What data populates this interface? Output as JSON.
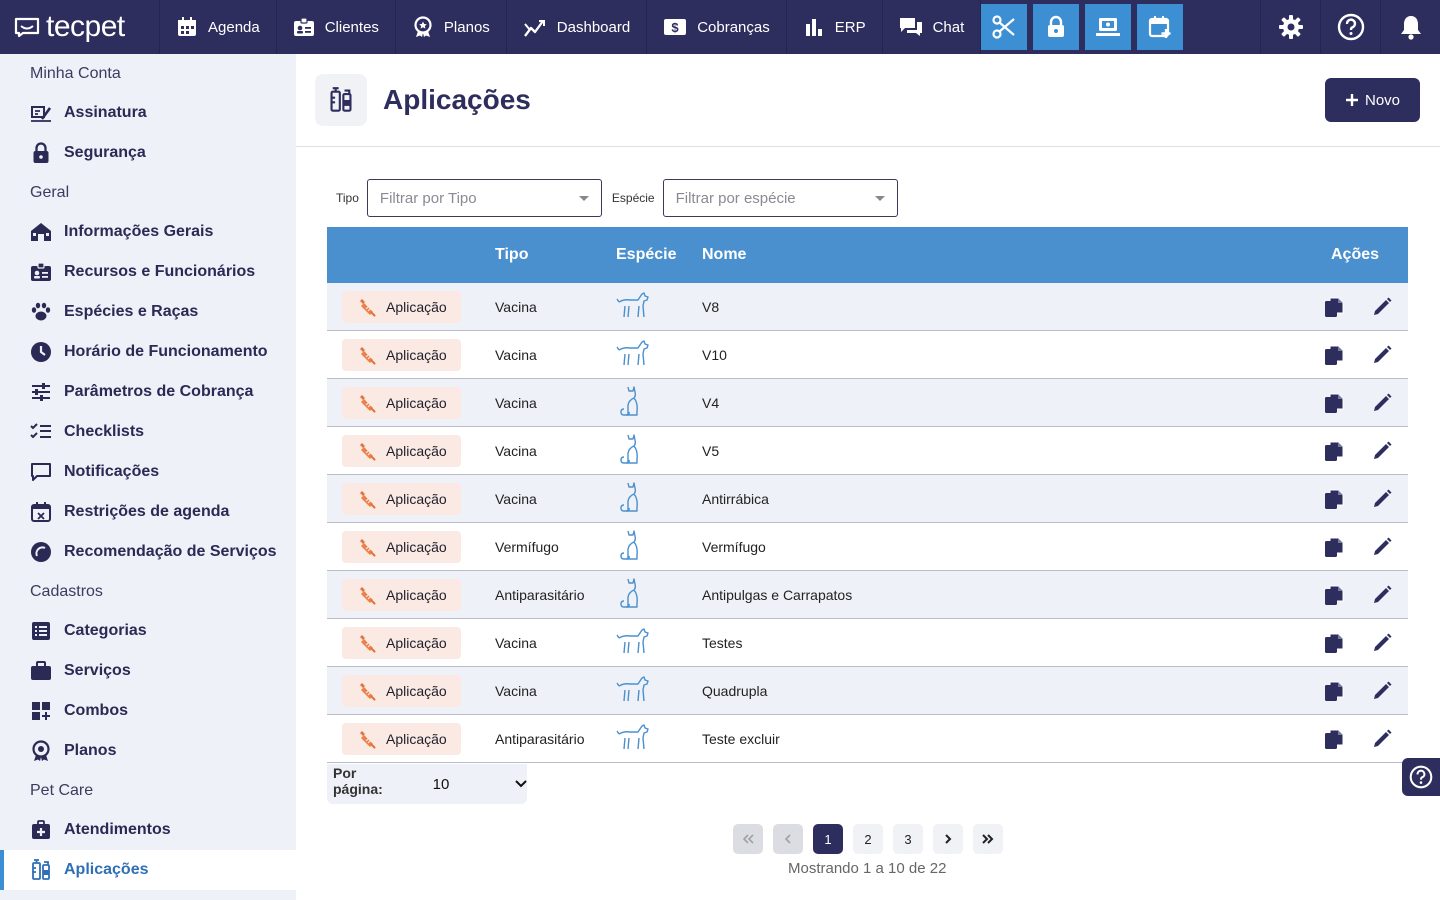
{
  "brand": {
    "name": "tecpet"
  },
  "nav": {
    "items": [
      {
        "label": "Agenda",
        "icon": "calendar-icon"
      },
      {
        "label": "Clientes",
        "icon": "id-badge-icon"
      },
      {
        "label": "Planos",
        "icon": "award-icon"
      },
      {
        "label": "Dashboard",
        "icon": "chart-line-icon"
      },
      {
        "label": "Cobranças",
        "icon": "dollar-icon"
      },
      {
        "label": "ERP",
        "icon": "bar-chart-icon"
      },
      {
        "label": "Chat",
        "icon": "chat-icon"
      }
    ],
    "tools": [
      "scissors-icon",
      "lock-icon",
      "register-icon",
      "calendar-add-icon"
    ],
    "right": [
      "gear-icon",
      "help-icon",
      "bell-icon"
    ]
  },
  "sidebar": {
    "sections": [
      {
        "title": "Minha Conta",
        "items": [
          {
            "label": "Assinatura",
            "icon": "signature-icon"
          },
          {
            "label": "Segurança",
            "icon": "lock-icon"
          }
        ]
      },
      {
        "title": "Geral",
        "items": [
          {
            "label": "Informações Gerais",
            "icon": "store-icon"
          },
          {
            "label": "Recursos e Funcionários",
            "icon": "id-badge-icon"
          },
          {
            "label": "Espécies e Raças",
            "icon": "paw-icon"
          },
          {
            "label": "Horário de Funcionamento",
            "icon": "clock-icon"
          },
          {
            "label": "Parâmetros de Cobrança",
            "icon": "sliders-icon"
          },
          {
            "label": "Checklists",
            "icon": "checklist-icon"
          },
          {
            "label": "Notificações",
            "icon": "message-icon"
          },
          {
            "label": "Restrições de agenda",
            "icon": "calendar-x-icon"
          },
          {
            "label": "Recomendação de Serviços",
            "icon": "recommend-icon"
          }
        ]
      },
      {
        "title": "Cadastros",
        "items": [
          {
            "label": "Categorias",
            "icon": "list-icon"
          },
          {
            "label": "Serviços",
            "icon": "briefcase-icon"
          },
          {
            "label": "Combos",
            "icon": "grid-plus-icon"
          },
          {
            "label": "Planos",
            "icon": "award-icon"
          }
        ]
      },
      {
        "title": "Pet Care",
        "items": [
          {
            "label": "Atendimentos",
            "icon": "medical-kit-icon"
          },
          {
            "label": "Aplicações",
            "icon": "syringe-icon",
            "active": true
          }
        ]
      }
    ]
  },
  "page": {
    "title": "Aplicações",
    "new_label": "Novo"
  },
  "filters": {
    "tipo_label": "Tipo",
    "tipo_placeholder": "Filtrar por Tipo",
    "especie_label": "Espécie",
    "especie_placeholder": "Filtrar por espécie"
  },
  "table": {
    "headers": {
      "tipo": "Tipo",
      "especie": "Espécie",
      "nome": "Nome",
      "acoes": "Ações"
    },
    "rows": [
      {
        "badge": "Aplicação",
        "tipo": "Vacina",
        "especie": "dog",
        "nome": "V8"
      },
      {
        "badge": "Aplicação",
        "tipo": "Vacina",
        "especie": "dog",
        "nome": "V10"
      },
      {
        "badge": "Aplicação",
        "tipo": "Vacina",
        "especie": "cat",
        "nome": "V4"
      },
      {
        "badge": "Aplicação",
        "tipo": "Vacina",
        "especie": "cat",
        "nome": "V5"
      },
      {
        "badge": "Aplicação",
        "tipo": "Vacina",
        "especie": "cat",
        "nome": "Antirrábica"
      },
      {
        "badge": "Aplicação",
        "tipo": "Vermífugo",
        "especie": "cat",
        "nome": "Vermífugo"
      },
      {
        "badge": "Aplicação",
        "tipo": "Antiparasitário",
        "especie": "cat",
        "nome": "Antipulgas e Carrapatos"
      },
      {
        "badge": "Aplicação",
        "tipo": "Vacina",
        "especie": "dog",
        "nome": "Testes"
      },
      {
        "badge": "Aplicação",
        "tipo": "Vacina",
        "especie": "dog",
        "nome": "Quadrupla"
      },
      {
        "badge": "Aplicação",
        "tipo": "Antiparasitário",
        "especie": "dog",
        "nome": "Teste excluir"
      }
    ]
  },
  "pagination": {
    "per_page_label": "Por página:",
    "per_page_value": "10",
    "pages": [
      "1",
      "2",
      "3"
    ],
    "current": "1",
    "summary": "Mostrando 1 a 10 de 22"
  },
  "colors": {
    "navy": "#2e2e5e",
    "accent": "#4a90cf",
    "badge_bg": "#fbeae3",
    "badge_icon": "#e8733a"
  }
}
